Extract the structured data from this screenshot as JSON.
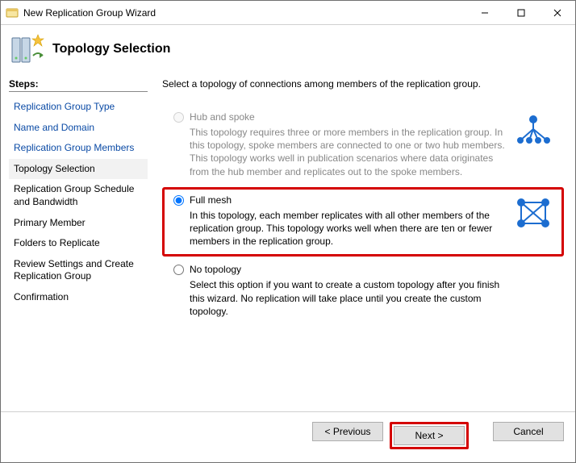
{
  "window": {
    "title": "New Replication Group Wizard"
  },
  "header": {
    "title": "Topology Selection"
  },
  "steps": {
    "label": "Steps:",
    "items": [
      {
        "label": "Replication Group Type",
        "state": "done"
      },
      {
        "label": "Name and Domain",
        "state": "done"
      },
      {
        "label": "Replication Group Members",
        "state": "done"
      },
      {
        "label": "Topology Selection",
        "state": "current"
      },
      {
        "label": "Replication Group Schedule and Bandwidth",
        "state": "pending"
      },
      {
        "label": "Primary Member",
        "state": "pending"
      },
      {
        "label": "Folders to Replicate",
        "state": "pending"
      },
      {
        "label": "Review Settings and Create Replication Group",
        "state": "pending"
      },
      {
        "label": "Confirmation",
        "state": "pending"
      }
    ]
  },
  "content": {
    "instruction": "Select a topology of connections among members of the replication group.",
    "options": {
      "hub_spoke": {
        "title": "Hub and spoke",
        "desc": "This topology requires three or more members in the replication group. In this topology, spoke members are connected to one or two hub members. This topology works well in publication scenarios where data originates from the hub member and replicates out to the spoke members.",
        "enabled": false,
        "selected": false
      },
      "full_mesh": {
        "title": "Full mesh",
        "desc": "In this topology, each member replicates with all other members of the replication group. This topology works well when there are ten or fewer members in the replication group.",
        "enabled": true,
        "selected": true
      },
      "no_topology": {
        "title": "No topology",
        "desc": "Select this option if you want to create a custom topology after you finish this wizard. No replication will take place until you create the custom topology.",
        "enabled": true,
        "selected": false
      }
    }
  },
  "footer": {
    "previous": "< Previous",
    "next": "Next >",
    "cancel": "Cancel"
  }
}
